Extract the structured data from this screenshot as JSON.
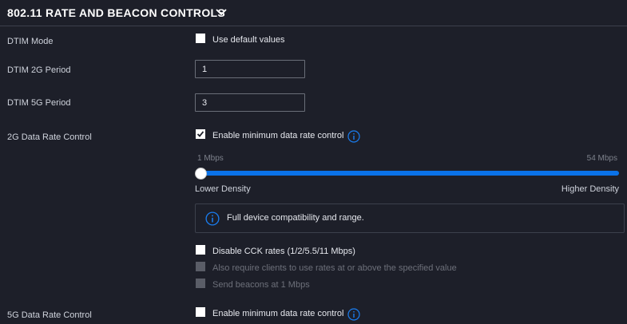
{
  "section": {
    "title": "802.11 RATE AND BEACON CONTROLS"
  },
  "dtim_mode": {
    "label": "DTIM Mode",
    "checkbox_label": "Use default values",
    "checked": false
  },
  "dtim_2g": {
    "label": "DTIM 2G Period",
    "value": "1"
  },
  "dtim_5g": {
    "label": "DTIM 5G Period",
    "value": "3"
  },
  "rate_2g": {
    "label": "2G Data Rate Control",
    "checkbox_label": "Enable minimum data rate control",
    "checked": true,
    "slider": {
      "min_label": "1 Mbps",
      "max_label": "54 Mbps",
      "level": 0
    },
    "low_density_label": "Lower Density",
    "high_density_label": "Higher Density",
    "info_text": "Full device compatibility and range.",
    "cck": {
      "label": "Disable CCK rates (1/2/5.5/11 Mbps)",
      "checked": false
    },
    "require_rates": {
      "label": "Also require clients to use rates at or above the specified value",
      "disabled": true
    },
    "beacons": {
      "label": "Send beacons at 1 Mbps",
      "disabled": true
    }
  },
  "rate_5g": {
    "label": "5G Data Rate Control",
    "checkbox_label": "Enable minimum data rate control",
    "checked": false
  },
  "colors": {
    "accent": "#0a72e8",
    "background": "#1d1f29",
    "border": "#3c404c"
  }
}
